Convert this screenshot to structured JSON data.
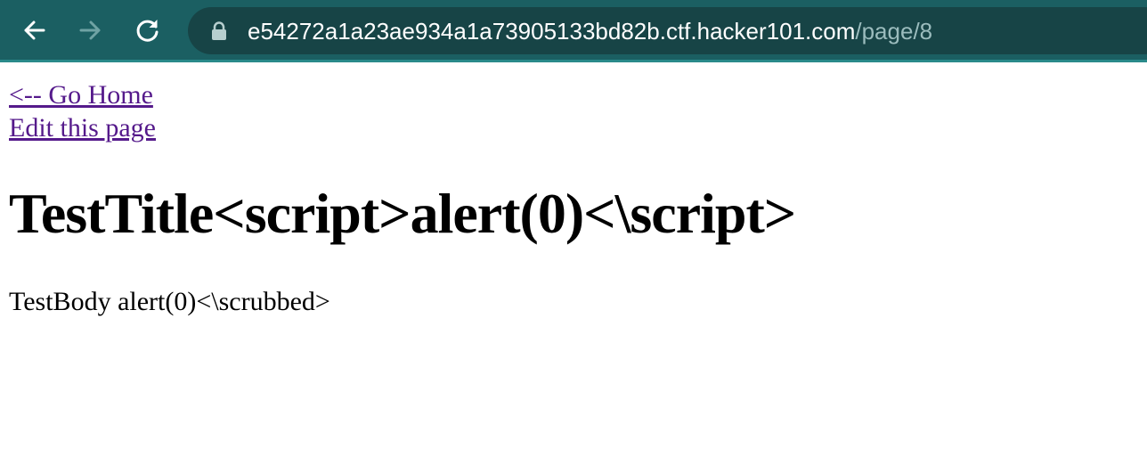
{
  "browser": {
    "url_host": "e54272a1a23ae934a1a73905133bd82b.ctf.hacker101.com",
    "url_path": "/page/8",
    "icons": {
      "back": "arrow-left-icon",
      "forward": "arrow-right-icon",
      "reload": "reload-icon",
      "security": "lock-icon"
    },
    "colors": {
      "toolbar": "#1b5f62",
      "omnibox": "#174446",
      "path": "#9bbcbd"
    }
  },
  "page": {
    "home_link": "<-- Go Home",
    "edit_link": "Edit this page",
    "title": "TestTitle<script>alert(0)<\\script>",
    "body": "TestBody alert(0)<\\scrubbed>",
    "link_color": "#551a8b"
  }
}
